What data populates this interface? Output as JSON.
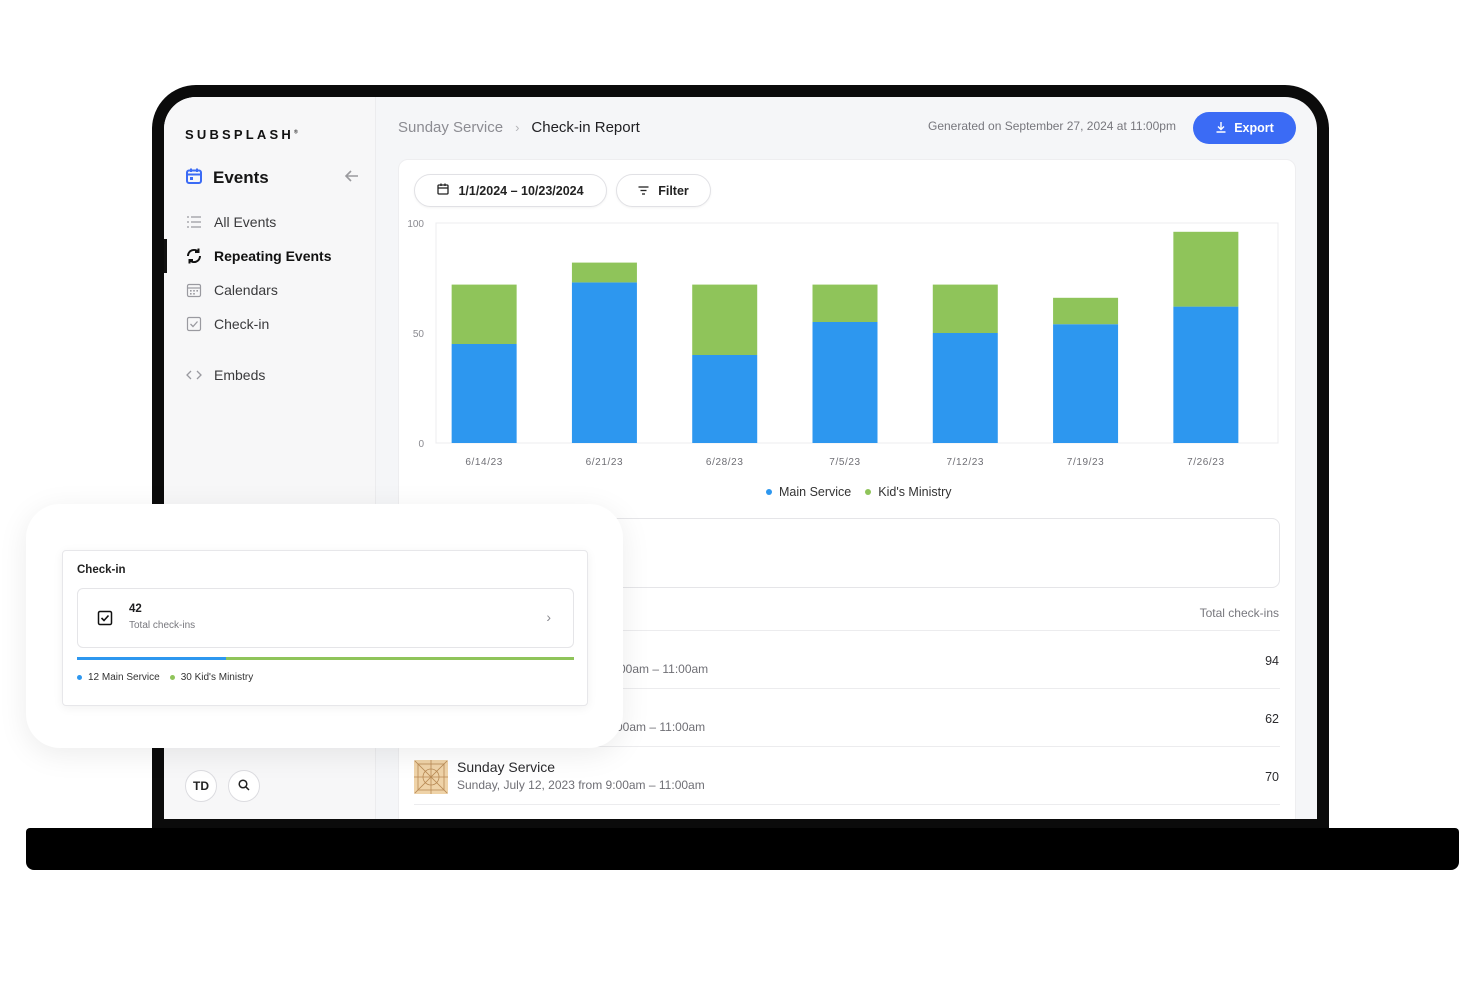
{
  "app": {
    "logo": "SUBSPLASH",
    "section_title": "Events"
  },
  "sidebar": {
    "items": [
      {
        "label": "All Events",
        "icon": "list-icon"
      },
      {
        "label": "Repeating Events",
        "icon": "repeat-icon",
        "active": true
      },
      {
        "label": "Calendars",
        "icon": "calendar-grid-icon"
      },
      {
        "label": "Check-in",
        "icon": "checkbox-icon"
      },
      {
        "label": "Embeds",
        "icon": "code-icon"
      }
    ],
    "user_initials": "TD"
  },
  "header": {
    "breadcrumb_parent": "Sunday Service",
    "breadcrumb_current": "Check-in Report",
    "generated": "Generated on September 27, 2024 at 11:00pm",
    "export_label": "Export"
  },
  "filters": {
    "date_range": "1/1/2024 – 10/23/2024",
    "filter_label": "Filter"
  },
  "chart_data": {
    "type": "bar",
    "stacked": true,
    "categories": [
      "6/14/23",
      "6/21/23",
      "6/28/23",
      "7/5/23",
      "7/12/23",
      "7/19/23",
      "7/26/23"
    ],
    "series": [
      {
        "name": "Main Service",
        "color": "#2d97ef",
        "values": [
          45,
          73,
          40,
          55,
          50,
          54,
          62
        ]
      },
      {
        "name": "Kid's Ministry",
        "color": "#8fc45a",
        "values": [
          27,
          9,
          32,
          17,
          22,
          12,
          34
        ]
      }
    ],
    "ylim": [
      0,
      100
    ],
    "yticks": [
      0,
      50,
      100
    ],
    "legend": "bottom-center"
  },
  "table": {
    "column_header": "Total check-ins",
    "rows": [
      {
        "time": "00am – 11:00am",
        "total": "94"
      },
      {
        "time": "00am – 11:00am",
        "total": "62"
      },
      {
        "title": "Sunday Service",
        "subtitle": "Sunday, July 12, 2023 from 9:00am – 11:00am",
        "total": "70"
      }
    ]
  },
  "popover": {
    "title": "Check-in",
    "total_value": "42",
    "total_label": "Total check-ins",
    "main_fraction": 0.3,
    "legend_main": "12 Main Service",
    "legend_kids": "30 Kid's Ministry"
  },
  "colors": {
    "accent": "#3b6bf5",
    "main_service": "#2d97ef",
    "kids_ministry": "#8fc45a"
  }
}
